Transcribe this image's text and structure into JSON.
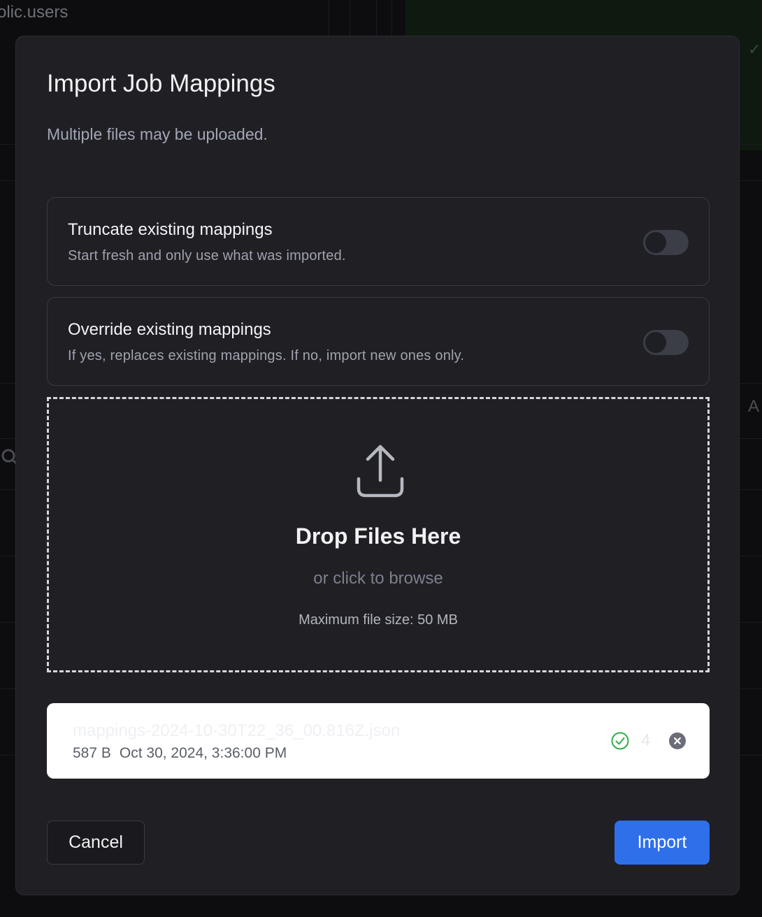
{
  "background": {
    "table_label": "olic.users",
    "partial_letter": "A",
    "check_glyph": "✓"
  },
  "dialog": {
    "title": "Import Job Mappings",
    "subtitle": "Multiple files may be uploaded."
  },
  "options": [
    {
      "title": "Truncate existing mappings",
      "description": "Start fresh and only use what was imported.",
      "enabled": false
    },
    {
      "title": "Override existing mappings",
      "description": "If yes, replaces existing mappings. If no, import new ones only.",
      "enabled": false
    }
  ],
  "dropzone": {
    "title": "Drop Files Here",
    "subtitle": "or click to browse",
    "max_size": "Maximum file size: 50 MB",
    "icon": "upload-icon"
  },
  "file": {
    "name": "mappings-2024-10-30T22_36_00.816Z.json",
    "size": "587 B",
    "date": "Oct 30, 2024, 3:36:00 PM",
    "status_icon": "check-circle-icon",
    "count": "4",
    "remove_icon": "close-circle-icon"
  },
  "footer": {
    "cancel_label": "Cancel",
    "import_label": "Import"
  },
  "colors": {
    "modal_bg": "#1f1f24",
    "accent": "#2f6fe9",
    "success": "#2fae4a"
  }
}
